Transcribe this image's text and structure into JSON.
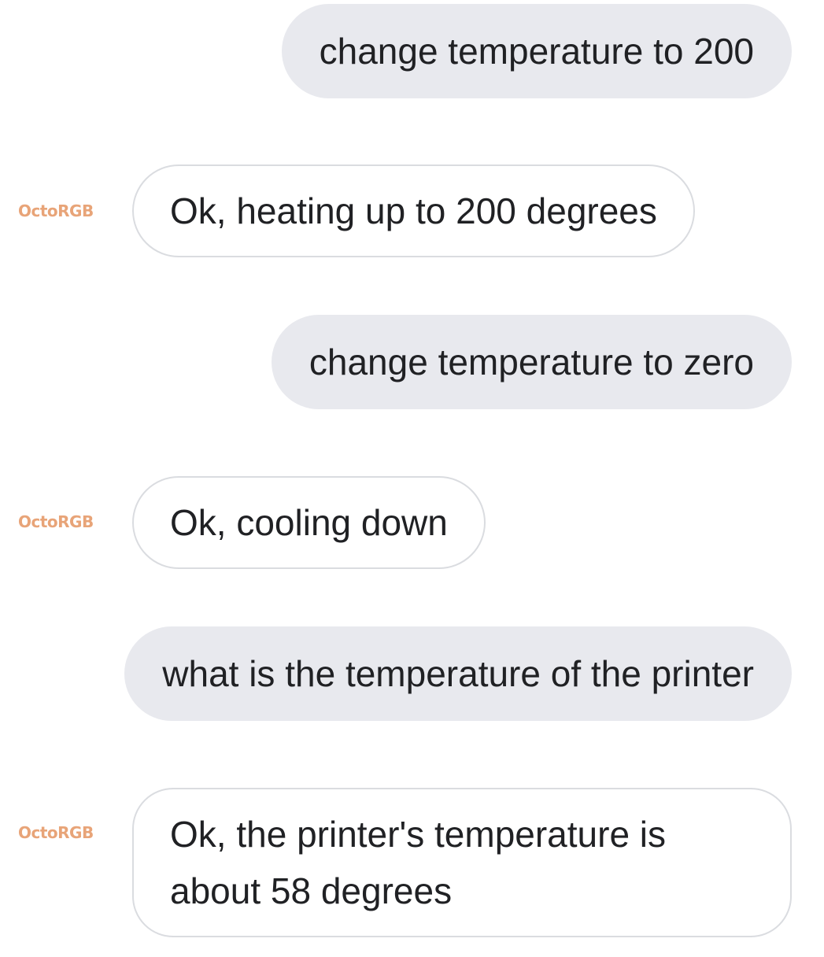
{
  "conversation": {
    "bot_name": "OctoRGB",
    "messages": [
      {
        "sender": "user",
        "text": "change temperature to 200"
      },
      {
        "sender": "bot",
        "text": "Ok, heating up to 200 degrees"
      },
      {
        "sender": "user",
        "text": "change temperature to zero"
      },
      {
        "sender": "bot",
        "text": "Ok, cooling down"
      },
      {
        "sender": "user",
        "text": "what is the temperature of the printer"
      },
      {
        "sender": "bot",
        "text": "Ok, the printer's temperature is about 58 degrees"
      }
    ]
  },
  "colors": {
    "user_bubble": "#e8e9ee",
    "bot_bubble_border": "#dadce0",
    "bot_label": "#e8a478",
    "text": "#202124"
  }
}
